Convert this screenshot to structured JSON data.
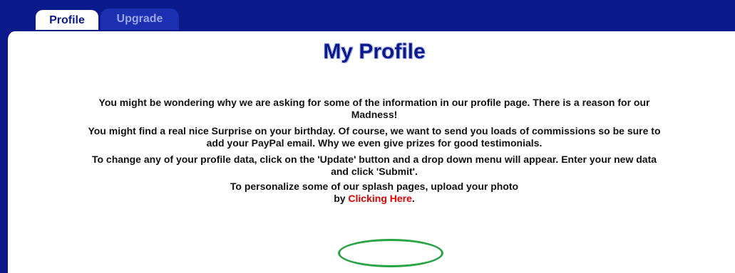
{
  "tabs": [
    {
      "label": "Profile",
      "active": true
    },
    {
      "label": "Upgrade",
      "active": false
    }
  ],
  "main": {
    "title": "My Profile",
    "paragraphs": [
      {
        "line1": "You might be wondering why we are asking for some of the information in our profile page. There is a reason for our",
        "line2": "Madness!"
      },
      {
        "line1": "You might find a real nice Surprise on your birthday. Of course, we want to send you loads of commissions so be sure to",
        "line2": "add your PayPal email. Why we even give prizes for good testimonials."
      },
      {
        "line1": "To change any of your profile data, click on the 'Update' button and a drop down menu will appear. Enter your new data",
        "line2": "and click 'Submit'."
      }
    ],
    "photo": {
      "line1": "To personalize some of our splash pages, upload your photo",
      "prefix": "by ",
      "link_label": "Clicking Here",
      "suffix": "."
    }
  },
  "colors": {
    "header_bg": "#0b1a8a",
    "link": "#e00000",
    "highlight_ellipse": "#27a344"
  }
}
